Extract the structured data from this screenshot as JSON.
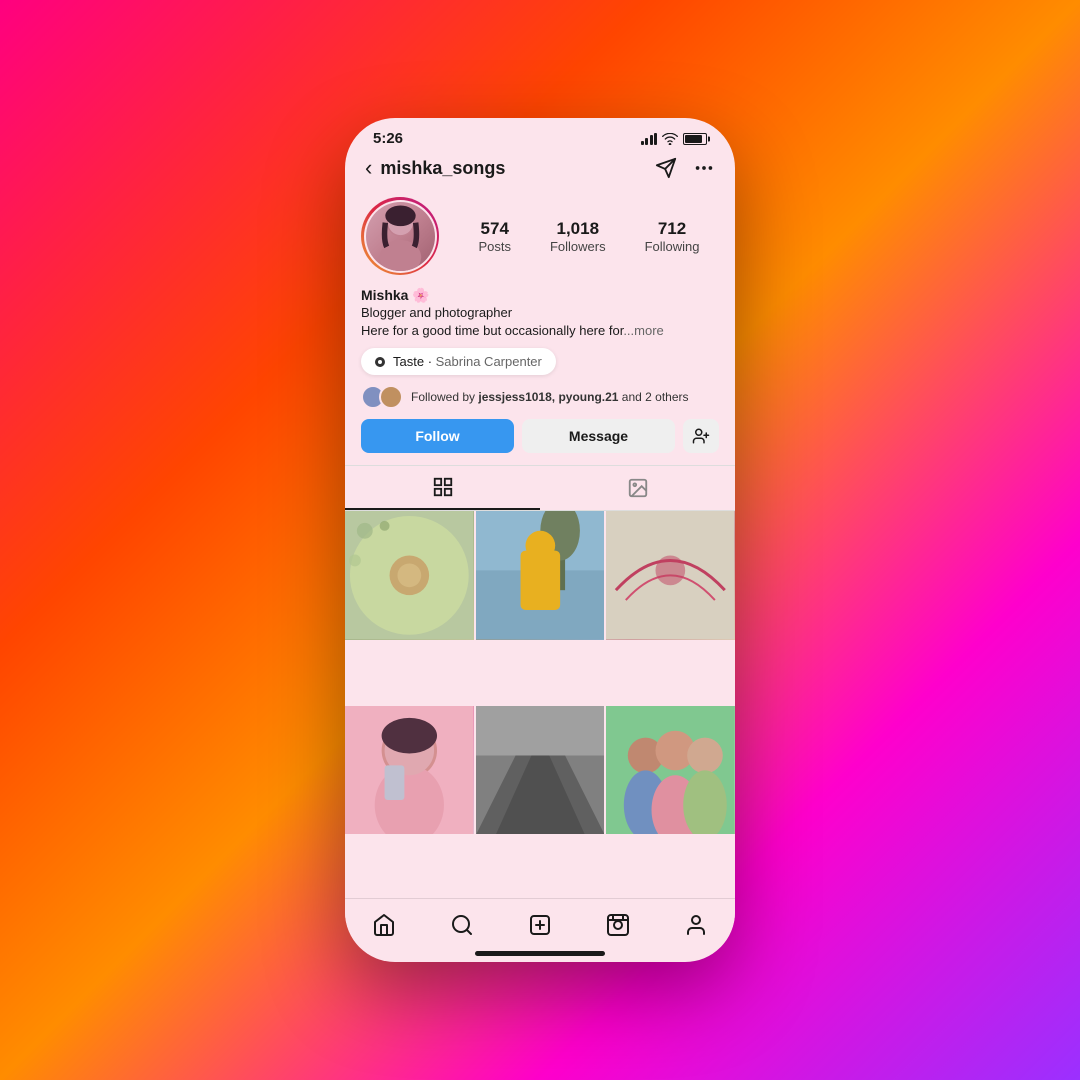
{
  "background": {
    "gradient": "linear-gradient(135deg, #ff0080 0%, #ff4500 30%, #ff8c00 50%, #ff00cc 75%, #9b30ff 100%)"
  },
  "phone": {
    "status_bar": {
      "time": "5:26"
    },
    "nav": {
      "username": "mishka_songs",
      "back_label": "‹",
      "send_icon": "send",
      "more_icon": "more"
    },
    "profile": {
      "name": "Mishka 🌸",
      "bio_line1": "Blogger and photographer",
      "bio_line2": "Here for a good time but occasionally here for",
      "bio_more": "...more",
      "stats": {
        "posts_count": "574",
        "posts_label": "Posts",
        "followers_count": "1,018",
        "followers_label": "Followers",
        "following_count": "712",
        "following_label": "Following"
      }
    },
    "music": {
      "song": "Taste",
      "artist": "Sabrina Carpenter"
    },
    "followed_by": {
      "text": "Followed by ",
      "names": "jessjess1018, pyoung.21",
      "suffix": " and 2 others"
    },
    "buttons": {
      "follow": "Follow",
      "message": "Message",
      "add_icon": "+👤"
    },
    "tabs": {
      "grid_label": "grid",
      "tag_label": "tag"
    },
    "bottom_nav": {
      "home": "home",
      "search": "search",
      "create": "create",
      "reels": "reels",
      "profile": "profile"
    }
  }
}
